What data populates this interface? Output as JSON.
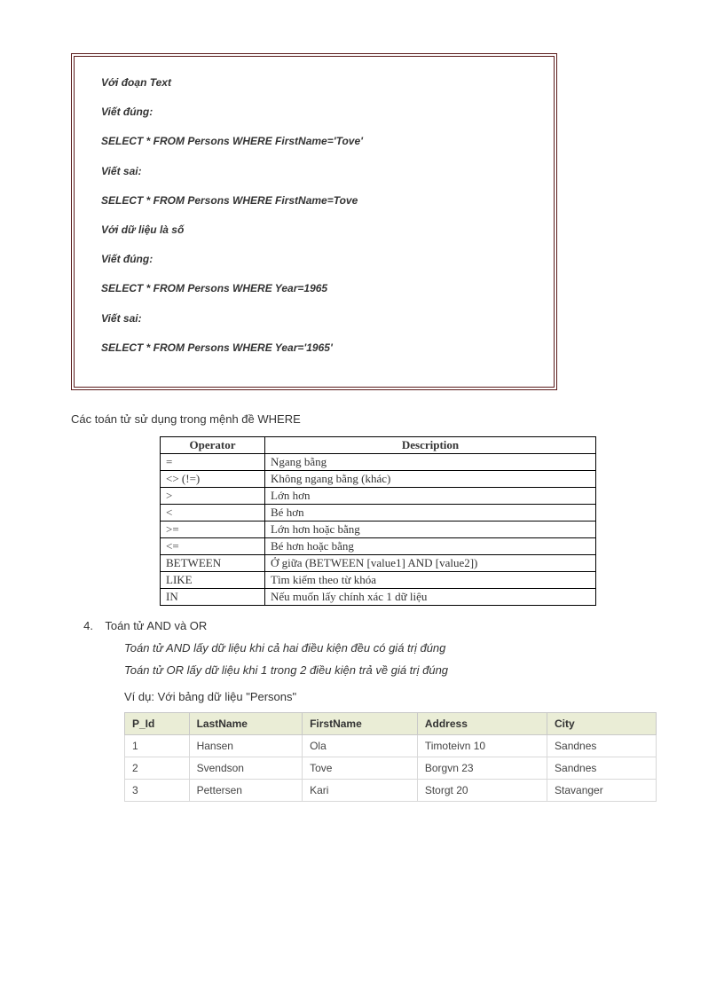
{
  "code_box": {
    "lines": [
      "Với đoạn Text",
      "Viết đúng:",
      "SELECT * FROM Persons WHERE FirstName='Tove'",
      "Viết sai:",
      "SELECT * FROM Persons WHERE FirstName=Tove",
      "Với dữ liệu là số",
      "Viết đúng:",
      "SELECT * FROM Persons WHERE Year=1965",
      "Viết sai:",
      "SELECT * FROM Persons WHERE Year='1965'"
    ]
  },
  "operators_title": "Các toán tử sử dụng trong mệnh đề WHERE",
  "operators_table": {
    "headers": [
      "Operator",
      "Description"
    ],
    "rows": [
      [
        "=",
        "Ngang bằng"
      ],
      [
        "<> (!=)",
        "Không ngang bằng (khác)"
      ],
      [
        ">",
        "Lớn hơn"
      ],
      [
        "<",
        "Bé hơn"
      ],
      [
        ">=",
        "Lớn hơn hoặc bằng"
      ],
      [
        "<=",
        "Bé hơn hoặc bằng"
      ],
      [
        "BETWEEN",
        "Ở giữa (BETWEEN [value1] AND [value2])"
      ],
      [
        "LIKE",
        "Tìm kiếm theo từ khóa"
      ],
      [
        "IN",
        "Nếu muốn lấy chính xác 1 dữ liệu"
      ]
    ]
  },
  "section4": {
    "number": "4.",
    "title": "Toán tử AND và OR",
    "line1": "Toán tử AND lấy dữ liệu khi cả hai điều kiện đều có giá trị đúng",
    "line2": "Toán tử OR lấy dữ liệu khi 1 trong 2 điều kiện trả về giá trị đúng",
    "example_label": "Ví dụ: Với bảng dữ liệu \"Persons\""
  },
  "persons_table": {
    "headers": [
      "P_Id",
      "LastName",
      "FirstName",
      "Address",
      "City"
    ],
    "rows": [
      [
        "1",
        "Hansen",
        "Ola",
        "Timoteivn 10",
        "Sandnes"
      ],
      [
        "2",
        "Svendson",
        "Tove",
        "Borgvn 23",
        "Sandnes"
      ],
      [
        "3",
        "Pettersen",
        "Kari",
        "Storgt 20",
        "Stavanger"
      ]
    ]
  }
}
